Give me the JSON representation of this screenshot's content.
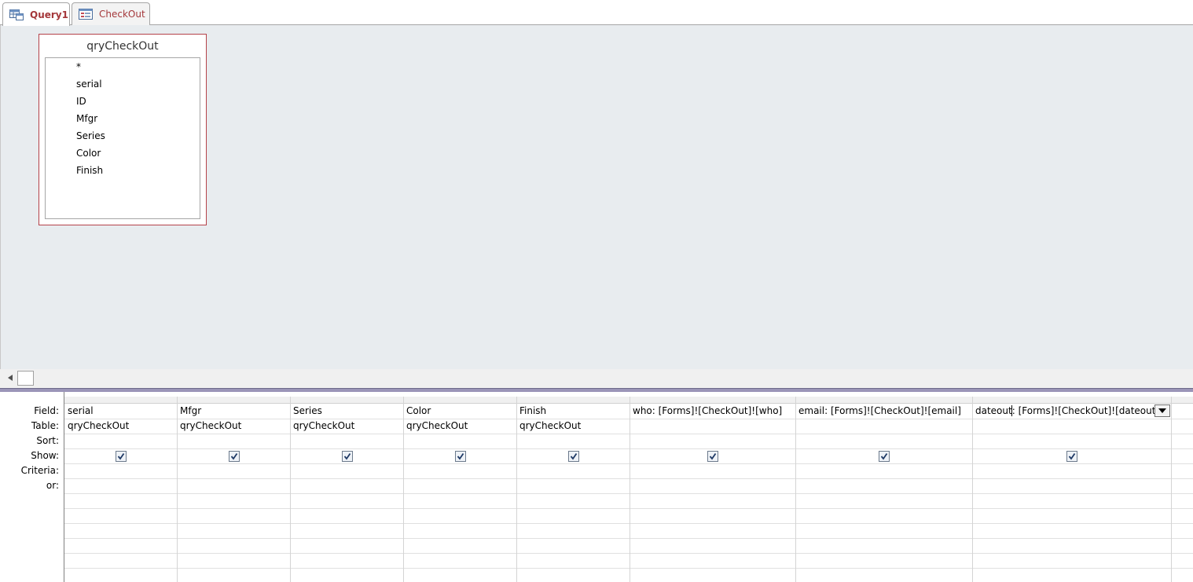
{
  "tabs": [
    {
      "label": "Query1",
      "icon": "query-icon",
      "active": true
    },
    {
      "label": "CheckOut",
      "icon": "form-icon",
      "active": false
    }
  ],
  "table_box": {
    "title": "qryCheckOut",
    "fields": [
      "*",
      "serial",
      "ID",
      "Mfgr",
      "Series",
      "Color",
      "Finish"
    ]
  },
  "grid": {
    "row_labels": [
      "Field:",
      "Table:",
      "Sort:",
      "Show:",
      "Criteria:",
      "or:"
    ],
    "columns": [
      {
        "field": "serial",
        "table": "qryCheckOut",
        "show": true
      },
      {
        "field": "Mfgr",
        "table": "qryCheckOut",
        "show": true
      },
      {
        "field": "Series",
        "table": "qryCheckOut",
        "show": true
      },
      {
        "field": "Color",
        "table": "qryCheckOut",
        "show": true
      },
      {
        "field": "Finish",
        "table": "qryCheckOut",
        "show": true
      },
      {
        "field": "who: [Forms]![CheckOut]![who]",
        "table": "",
        "show": true
      },
      {
        "field": "email: [Forms]![CheckOut]![email]",
        "table": "",
        "show": true
      },
      {
        "field": "dateout: [Forms]![CheckOut]![dateout]",
        "table": "",
        "show": true
      }
    ]
  },
  "colors": {
    "accent": "#a4373a",
    "surface": "#e8ecef",
    "splitter": "#9b95b8"
  }
}
